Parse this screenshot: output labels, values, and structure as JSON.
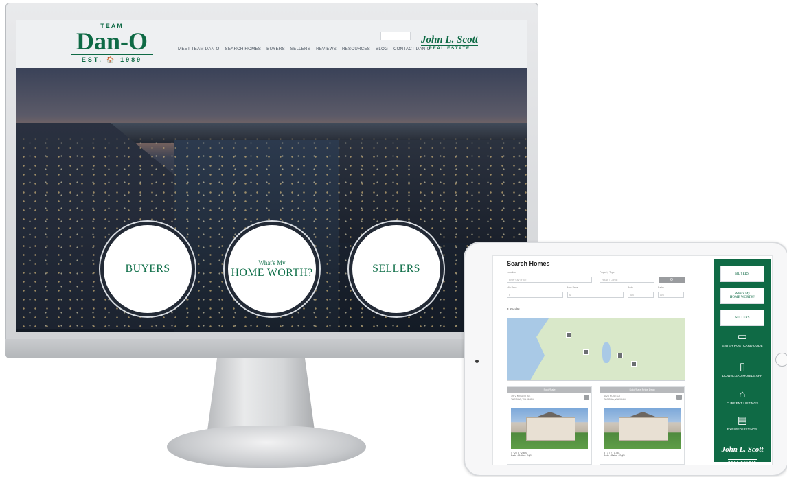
{
  "monitor": {
    "logo": {
      "team": "TEAM",
      "name": "Dan-O",
      "est": "EST. 🏠 1989"
    },
    "nav": [
      "MEET TEAM DAN-O",
      "SEARCH HOMES",
      "BUYERS",
      "SELLERS",
      "REVIEWS",
      "RESOURCES",
      "BLOG",
      "CONTACT DAN-O"
    ],
    "brokerage": {
      "name": "John L. Scott",
      "sub": "REAL ESTATE"
    },
    "hero": {
      "buyers": "BUYERS",
      "home_worth_small": "What's My",
      "home_worth_big": "HOME WORTH?",
      "sellers": "SELLERS"
    }
  },
  "tablet": {
    "title": "Search Homes",
    "location_label": "Location",
    "location_placeholder": "Enter City or Zip",
    "property_type_label": "Property Type",
    "property_type_value": "House / Condo",
    "search_button": "Q",
    "min_price_label": "Min Price",
    "min_price_value": "$",
    "max_price_label": "Max Price",
    "max_price_value": "$",
    "beds_label": "Beds",
    "beds_value": "Any",
    "baths_label": "Baths",
    "baths_value": "Any",
    "results_label": "3 Results",
    "cards": [
      {
        "head": "Sold/Sale",
        "address": "1972 KING ST SE\nTACOMA, WA 98404",
        "stats": "4 · 2 | 3 · 2,600\nBeds · Baths · SqFt"
      },
      {
        "head": "Sold/Sale Price Drop",
        "address": "4026 ROSE CT\nTACOMA, WA 98404",
        "stats": "3 · 1 | 2 · 1,451\nBeds · Baths · SqFt"
      }
    ],
    "side": {
      "buyers": "BUYERS",
      "home_worth_small": "What's My",
      "home_worth_big": "HOME WORTH?",
      "sellers": "SELLERS",
      "postcard": "ENTER POSTCARD CODE",
      "mobile_app": "DOWNLOAD MOBILE APP",
      "current_listings": "CURRENT LISTINGS",
      "expired_listings": "EXPIRED LISTINGS",
      "brokerage_name": "John L. Scott",
      "brokerage_sub": "REAL ESTATE"
    }
  },
  "colors": {
    "brand_green": "#0f6a45",
    "header_bg": "#eef0f2"
  }
}
